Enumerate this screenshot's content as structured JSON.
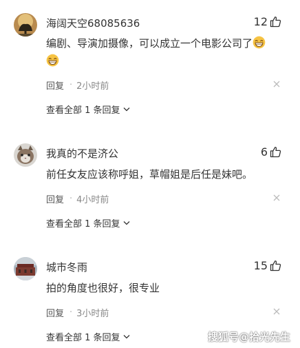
{
  "comments": [
    {
      "username": "海阔天空68085636",
      "likes": "12",
      "text": "编剧、导演加摄像，可以成立一个电影公司了",
      "emoji": "grinning-face-emoji",
      "reply_label": "回复",
      "separator": "·",
      "time": "2小时前",
      "view_replies": "查看全部 1 条回复"
    },
    {
      "username": "我真的不是济公",
      "likes": "6",
      "text": "前任女友应该称呼姐，草帽姐是后任是妹吧。",
      "reply_label": "回复",
      "separator": "·",
      "time": "4小时前",
      "view_replies": "查看全部 1 条回复"
    },
    {
      "username": "城市冬雨",
      "likes": "15",
      "text": "拍的角度也很好，很专业",
      "reply_label": "回复",
      "separator": "·",
      "time": "3小时前",
      "view_replies": "查看全部 1 条回复"
    }
  ],
  "icons": {
    "like": "thumbs-up-icon",
    "close": "close-icon",
    "expand": "chevron-down-icon"
  },
  "watermark": "搜狐号@拾光先生",
  "colors": {
    "text": "#333333",
    "meta": "#888888",
    "icon": "#bbbbbb",
    "emoji": "#f6c343"
  }
}
